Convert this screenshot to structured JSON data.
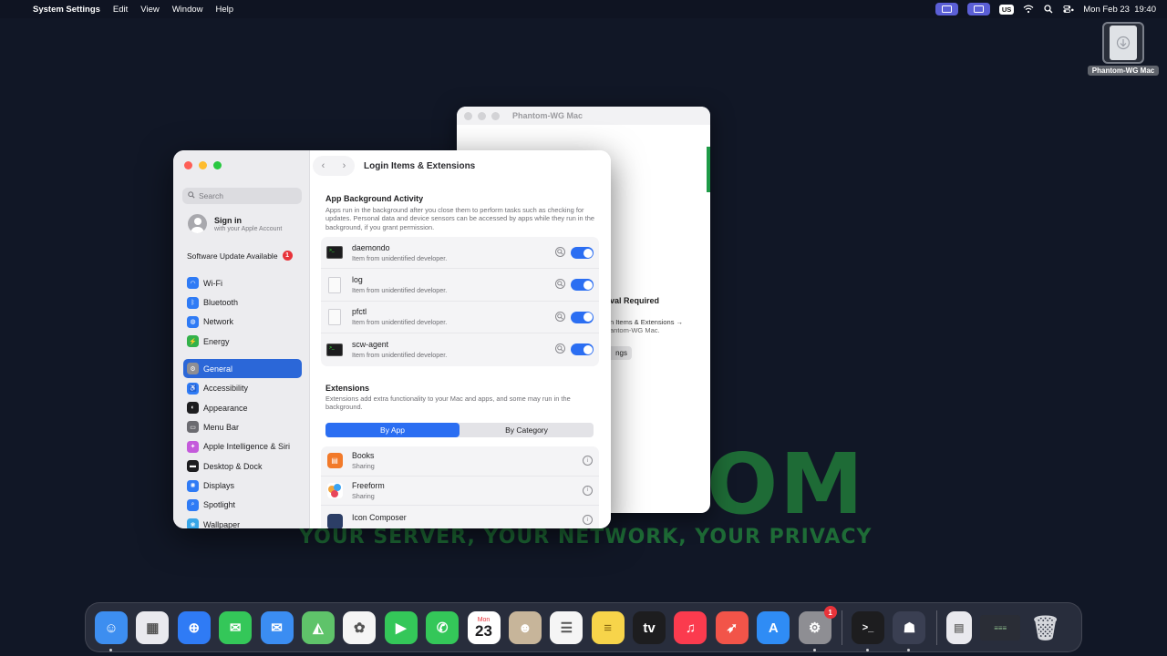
{
  "menubar": {
    "app_name": "System Settings",
    "menus": [
      "Edit",
      "View",
      "Window",
      "Help"
    ],
    "keyboard_layout": "US",
    "clock": "Mon Feb 23  19:40"
  },
  "desktop": {
    "item_label": "Phantom-WG Mac",
    "wallpaper_brand": "OM",
    "wallpaper_tagline": "YOUR SERVER, YOUR NETWORK, YOUR PRIVACY"
  },
  "phantom_window": {
    "title": "Phantom-WG Mac",
    "approval_text": "val Required",
    "line1": "n Items & Extensions →",
    "line2": "antom-WG Mac.",
    "button_label": "ngs"
  },
  "settings": {
    "search_placeholder": "Search",
    "signin_title": "Sign in",
    "signin_subtitle": "with your Apple Account",
    "software_update": "Software Update Available",
    "software_update_count": "1",
    "sidebar_group1": [
      {
        "label": "Wi-Fi",
        "color": "#2f7bf5",
        "glyph": "◠"
      },
      {
        "label": "Bluetooth",
        "color": "#2f7bf5",
        "glyph": "ᛒ"
      },
      {
        "label": "Network",
        "color": "#2f7bf5",
        "glyph": "◍"
      },
      {
        "label": "Energy",
        "color": "#33b24a",
        "glyph": "⚡"
      }
    ],
    "sidebar_group2": [
      {
        "label": "General",
        "color": "#8e8e93",
        "glyph": "⚙"
      },
      {
        "label": "Accessibility",
        "color": "#2f7bf5",
        "glyph": "♿"
      },
      {
        "label": "Appearance",
        "color": "#1d1d1f",
        "glyph": "◐"
      },
      {
        "label": "Menu Bar",
        "color": "#6b6b70",
        "glyph": "▭"
      },
      {
        "label": "Apple Intelligence & Siri",
        "color": "#c45adb",
        "glyph": "✦"
      },
      {
        "label": "Desktop & Dock",
        "color": "#1d1d1f",
        "glyph": "▬"
      },
      {
        "label": "Displays",
        "color": "#2f7bf5",
        "glyph": "✺"
      },
      {
        "label": "Spotlight",
        "color": "#2f7bf5",
        "glyph": "⌕"
      },
      {
        "label": "Wallpaper",
        "color": "#37a5e8",
        "glyph": "❀"
      }
    ],
    "page_title": "Login Items & Extensions",
    "bg_title": "App Background Activity",
    "bg_desc": "Apps run in the background after you close them to perform tasks such as checking for updates. Personal data and device sensors can be accessed by apps while they run in the background, if you grant permission.",
    "bg_items": [
      {
        "name": "daemondo",
        "sub": "Item from unidentified developer.",
        "icon": "terminal",
        "enabled": true
      },
      {
        "name": "log",
        "sub": "Item from unidentified developer.",
        "icon": "document",
        "enabled": true
      },
      {
        "name": "pfctl",
        "sub": "Item from unidentified developer.",
        "icon": "document",
        "enabled": true
      },
      {
        "name": "scw-agent",
        "sub": "Item from unidentified developer.",
        "icon": "terminal",
        "enabled": true
      }
    ],
    "ext_title": "Extensions",
    "ext_desc": "Extensions add extra functionality to your Mac and apps, and some may run in the background.",
    "seg_by_app": "By App",
    "seg_by_category": "By Category",
    "ext_items": [
      {
        "name": "Books",
        "sub": "Sharing"
      },
      {
        "name": "Freeform",
        "sub": "Sharing"
      },
      {
        "name": "Icon Composer",
        "sub": ""
      }
    ]
  },
  "dock": {
    "calendar_month": "Mon",
    "calendar_day": "23",
    "settings_badge": "1",
    "apps": [
      {
        "name": "Finder",
        "color": "#3d8ef0"
      },
      {
        "name": "Launchpad",
        "color": "#e9e9ee"
      },
      {
        "name": "Safari",
        "color": "#2f7bf5"
      },
      {
        "name": "Messages",
        "color": "#34c759"
      },
      {
        "name": "Mail",
        "color": "#3b8df2"
      },
      {
        "name": "Maps",
        "color": "#5fc36a"
      },
      {
        "name": "Photos",
        "color": "#f5f5f5"
      },
      {
        "name": "FaceTime",
        "color": "#34c759"
      },
      {
        "name": "Phone",
        "color": "#34c759"
      },
      {
        "name": "Calendar",
        "color": "#ffffff"
      },
      {
        "name": "Contacts",
        "color": "#c7b59a"
      },
      {
        "name": "Reminders",
        "color": "#f5f5f5"
      },
      {
        "name": "Notes",
        "color": "#f7d44a"
      },
      {
        "name": "TV",
        "color": "#1d1d1f"
      },
      {
        "name": "Music",
        "color": "#fb3b4e"
      },
      {
        "name": "Rocket",
        "color": "#f25449"
      },
      {
        "name": "App Store",
        "color": "#2f8cf5"
      },
      {
        "name": "System Settings",
        "color": "#8e8e93"
      }
    ]
  }
}
